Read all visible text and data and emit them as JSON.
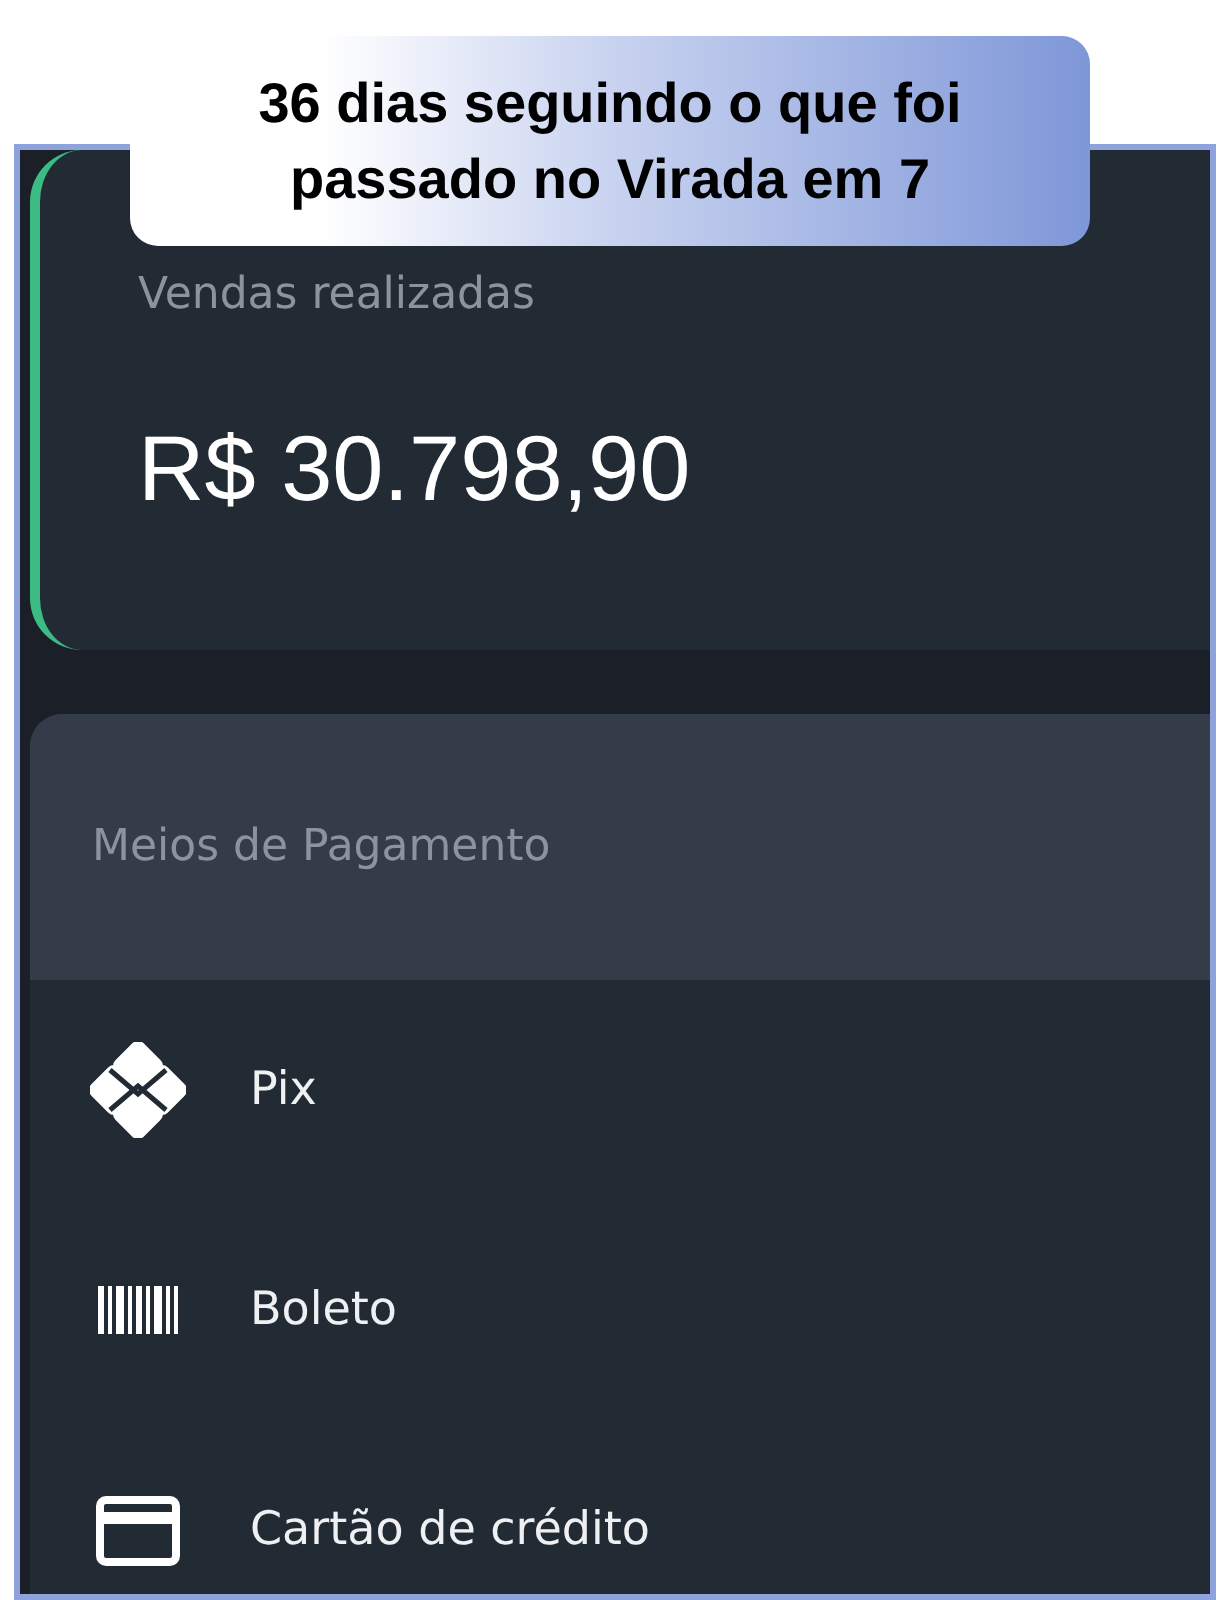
{
  "caption": {
    "lines": [
      "36 dias seguindo o que foi",
      "passado no Virada em 7"
    ]
  },
  "sales_card": {
    "label": "Vendas realizadas",
    "value": "R$ 30.798,90"
  },
  "payment_methods": {
    "title": "Meios de Pagamento",
    "items": [
      {
        "kind": "pix",
        "label": "Pix"
      },
      {
        "kind": "boleto",
        "label": "Boleto"
      },
      {
        "kind": "card",
        "label": "Cartão de crédito"
      }
    ]
  }
}
